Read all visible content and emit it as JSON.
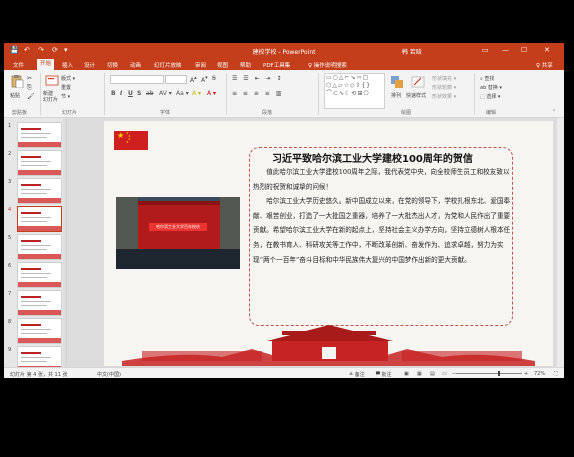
{
  "window": {
    "title": "建校学校 - PowerPoint",
    "user": "韩 若晗",
    "quick_access": [
      "💾",
      "↶",
      "↷",
      "⟳",
      "▾"
    ],
    "controls": [
      "▭",
      "—",
      "☐",
      "✕"
    ]
  },
  "tabs": [
    "文件",
    "开始",
    "插入",
    "设计",
    "切换",
    "动画",
    "幻灯片放映",
    "审阅",
    "视图",
    "帮助",
    "PDF工具集",
    "♀ 操作说明搜索"
  ],
  "active_tab": "开始",
  "share_label": "♀ 共享",
  "ribbon": {
    "groups": [
      "剪贴板",
      "幻灯片",
      "字体",
      "段落",
      "绘图",
      "编辑"
    ],
    "paste_label": "粘贴",
    "new_slide_label": "新建\n幻灯片",
    "slide_buttons": [
      "版式 ▾",
      "重置",
      "节 ▾"
    ],
    "font_buttons": [
      "B",
      "I",
      "U",
      "S",
      "ab",
      "AV ▾",
      "Aa ▾",
      "A ▾",
      "A ▾"
    ],
    "draw_buttons": [
      "排列",
      "快速样式"
    ],
    "shape_options": [
      "形状填充 ▾",
      "形状轮廓 ▾",
      "形状效果 ▾"
    ],
    "edit_buttons": [
      "查找",
      "替换 ▾",
      "选择 ▾"
    ]
  },
  "thumbnails": [
    "1",
    "2",
    "3",
    "4",
    "5",
    "6",
    "7",
    "8",
    "9"
  ],
  "selected_slide": 4,
  "slide": {
    "title": "习近平致哈尔滨工业大学建校100周年的贺信",
    "paragraphs": [
      "值此哈尔滨工业大学建校100周年之际，我代表党中央，向全校师生员工和校友致以热烈的祝贺和诚挚的问候！",
      "哈尔滨工业大学历史悠久。新中国成立以来，在党的领导下，学校扎根东北、爱国奉献、艰苦创业，打造了一大批国之重器，培养了一大批杰出人才，为党和人民作出了重要贡献。希望哈尔滨工业大学在新的起点上，坚持社会主义办学方向，坚持立德树人根本任务，在教书育人、科研攻关等工作中，不断改革创新、奋发作为、追求卓越，努力为实现“两个一百年”奋斗目标和中华民族伟大复兴的中国梦作出新的更大贡献。"
    ],
    "photo_banner": "哈尔滨工业大学百年校庆"
  },
  "status": {
    "slide_info": "幻灯片 第 4 张，共 11 张",
    "language": "中文(中国)",
    "notes": "≜ 备注",
    "comments": "▀ 批注",
    "zoom": "72%"
  },
  "colors": {
    "accent": "#c43e1c",
    "slide_red": "#c62323"
  }
}
